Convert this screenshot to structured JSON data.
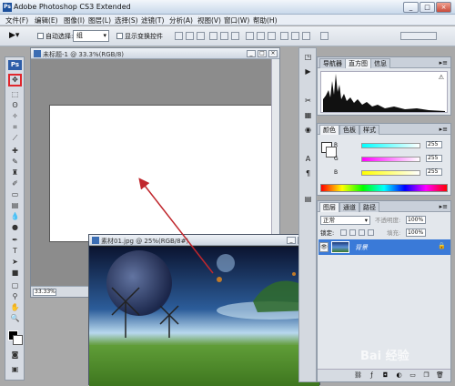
{
  "app": {
    "title": "Adobe Photoshop CS3 Extended",
    "logo": "Ps",
    "window_controls": [
      "_",
      "□",
      "×"
    ]
  },
  "menu": [
    "文件(F)",
    "编辑(E)",
    "图像(I)",
    "图层(L)",
    "选择(S)",
    "滤镜(T)",
    "分析(A)",
    "视图(V)",
    "窗口(W)",
    "帮助(H)"
  ],
  "options": {
    "auto_select_label": "自动选择:",
    "auto_select_value": "组",
    "show_transform_label": "显示变换控件"
  },
  "documents": {
    "doc1": {
      "title": "未标题-1 @ 33.3%(RGB/8)",
      "zoom": "33.33%"
    },
    "doc2": {
      "title": "素材01.jpg @ 25%(RGB/8#)"
    }
  },
  "panels": {
    "histogram_tabs": [
      "导航器",
      "直方图",
      "信息"
    ],
    "histogram_warning": "⚠",
    "color_tabs": [
      "颜色",
      "色板",
      "样式"
    ],
    "color": {
      "r_label": "R",
      "r_value": "255",
      "g_label": "G",
      "g_value": "255",
      "b_label": "B",
      "b_value": "255"
    },
    "layers_tabs": [
      "图层",
      "通道",
      "路径"
    ],
    "layers": {
      "blend_mode": "正常",
      "opacity_label": "不透明度:",
      "opacity_value": "100%",
      "lock_label": "锁定:",
      "fill_label": "填充:",
      "fill_value": "100%",
      "layer_name": "背景",
      "eye": "👁",
      "lock_icon": "🔒"
    }
  },
  "watermark": "Bai 经验",
  "colors": {
    "accent": "#3a7ad8",
    "arrow": "#c0272d",
    "selection_highlight": "#e0262c"
  }
}
